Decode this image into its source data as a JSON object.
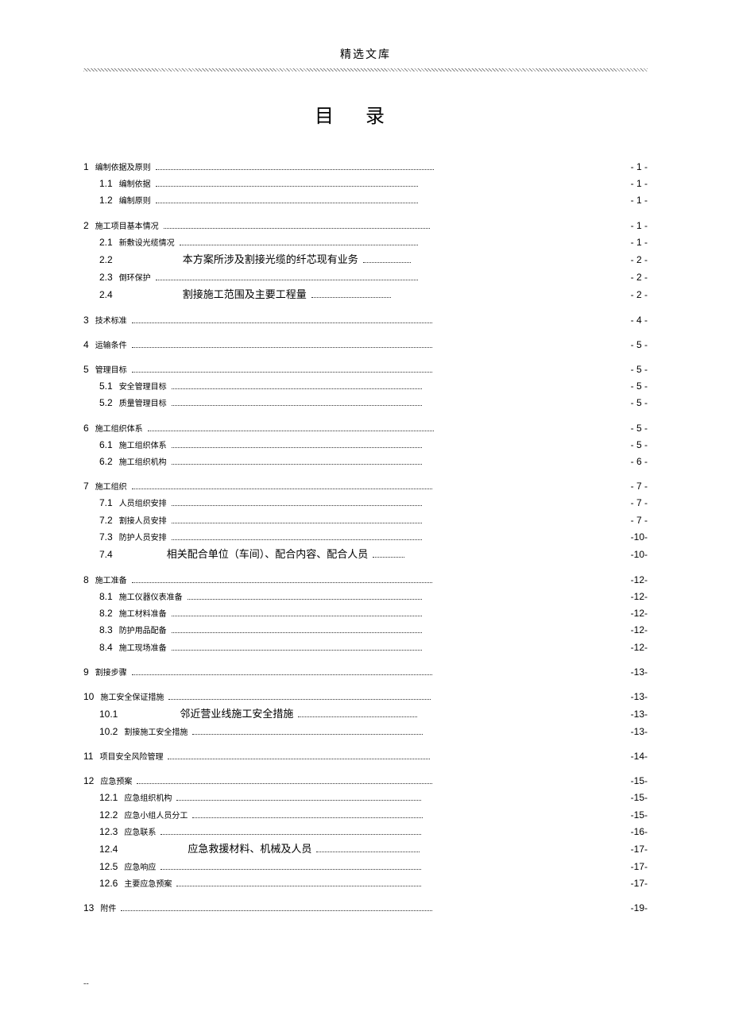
{
  "header": {
    "site": "精选文库"
  },
  "title": "目录",
  "toc": [
    {
      "level": 1,
      "num": "1",
      "label": "编制依据及原则",
      "page": "- 1 -",
      "dotw": 350
    },
    {
      "level": 2,
      "num": "1.1",
      "label": "编制依据",
      "page": "- 1 -",
      "dotw": 330
    },
    {
      "level": 2,
      "num": "1.2",
      "label": "编制原则",
      "page": "- 1 -",
      "dotw": 330
    },
    {
      "level": 1,
      "num": "2",
      "label": "施工项目基本情况",
      "page": "- 1 -",
      "dotw": 335
    },
    {
      "level": 2,
      "num": "2.1",
      "label": "新敷设光缆情况",
      "page": "- 1 -",
      "dotw": 300
    },
    {
      "level": 2,
      "num": "2.2",
      "label": "本方案所涉及割接光缆的纤芯现有业务",
      "big": true,
      "page": "- 2 -",
      "pad": 80,
      "dotw": 60
    },
    {
      "level": 2,
      "num": "2.3",
      "label": "倒环保护",
      "page": "- 2 -",
      "dotw": 330
    },
    {
      "level": 2,
      "num": "2.4",
      "label": "割接施工范围及主要工程量",
      "big": true,
      "page": "- 2 -",
      "pad": 80,
      "dotw": 100
    },
    {
      "level": 1,
      "num": "3",
      "label": "技术标准",
      "page": "- 4 -",
      "dotw": 378
    },
    {
      "level": 1,
      "num": "4",
      "label": "运输条件",
      "page": "- 5 -",
      "dotw": 378
    },
    {
      "level": 1,
      "num": "5",
      "label": "管理目标",
      "page": "- 5 -",
      "dotw": 378
    },
    {
      "level": 2,
      "num": "5.1",
      "label": "安全管理目标",
      "page": "- 5 -",
      "dotw": 315
    },
    {
      "level": 2,
      "num": "5.2",
      "label": "质量管理目标",
      "page": "- 5 -",
      "dotw": 315
    },
    {
      "level": 1,
      "num": "6",
      "label": "施工组织体系",
      "page": "- 5 -",
      "dotw": 360
    },
    {
      "level": 2,
      "num": "6.1",
      "label": "施工组织体系",
      "page": "- 5 -",
      "dotw": 315
    },
    {
      "level": 2,
      "num": "6.2",
      "label": "施工组织机构",
      "page": "- 6 -",
      "dotw": 315
    },
    {
      "level": 1,
      "num": "7",
      "label": "施工组织",
      "page": "- 7 -",
      "dotw": 378
    },
    {
      "level": 2,
      "num": "7.1",
      "label": "人员组织安排",
      "page": "- 7 -",
      "dotw": 315
    },
    {
      "level": 2,
      "num": "7.2",
      "label": "割接人员安排",
      "page": "- 7 -",
      "dotw": 315
    },
    {
      "level": 2,
      "num": "7.3",
      "label": "防护人员安排",
      "page": "-10-",
      "dotw": 315
    },
    {
      "level": 2,
      "num": "7.4",
      "label": "相关配合单位（车间）、配合内容、配合人员",
      "big": true,
      "page": "-10-",
      "pad": 60,
      "dotw": 20
    },
    {
      "level": 1,
      "num": "8",
      "label": "施工准备",
      "page": "-12-",
      "dotw": 378
    },
    {
      "level": 2,
      "num": "8.1",
      "label": "施工仪器仪表准备",
      "page": "-12-",
      "dotw": 295
    },
    {
      "level": 2,
      "num": "8.2",
      "label": "施工材料准备",
      "page": "-12-",
      "dotw": 315
    },
    {
      "level": 2,
      "num": "8.3",
      "label": "防护用品配备",
      "page": "-12-",
      "dotw": 315
    },
    {
      "level": 2,
      "num": "8.4",
      "label": "施工现场准备",
      "page": "-12-",
      "dotw": 315
    },
    {
      "level": 1,
      "num": "9",
      "label": "割接步骤",
      "page": "-13-",
      "dotw": 378
    },
    {
      "level": 1,
      "num": "10",
      "label": "施工安全保证措施",
      "page": "-13-",
      "dotw": 330
    },
    {
      "level": 2,
      "num": "10.1",
      "label": "邻近营业线施工安全措施",
      "big": true,
      "page": "-13-",
      "pad": 70,
      "dotw": 150
    },
    {
      "level": 2,
      "num": "10.2",
      "label": "割接施工安全措施",
      "page": "-13-",
      "dotw": 290
    },
    {
      "level": 1,
      "num": "11",
      "label": "项目安全风险管理",
      "page": "-14-",
      "dotw": 330
    },
    {
      "level": 1,
      "num": "12",
      "label": "应急预案",
      "page": "-15-",
      "dotw": 372
    },
    {
      "level": 2,
      "num": "12.1",
      "label": "应急组织机构",
      "page": "-15-",
      "dotw": 308
    },
    {
      "level": 2,
      "num": "12.2",
      "label": "应急小组人员分工",
      "page": "-15-",
      "dotw": 290
    },
    {
      "level": 2,
      "num": "12.3",
      "label": "应急联系",
      "page": "-16-",
      "dotw": 328
    },
    {
      "level": 2,
      "num": "12.4",
      "label": "应急救援材料、机械及人员",
      "big": true,
      "page": "-17-",
      "pad": 80,
      "dotw": 130
    },
    {
      "level": 2,
      "num": "12.5",
      "label": "应急响应",
      "page": "-17-",
      "dotw": 328
    },
    {
      "level": 2,
      "num": "12.6",
      "label": "主要应急预案",
      "page": "-17-",
      "dotw": 308
    },
    {
      "level": 1,
      "num": "13",
      "label": "附件",
      "page": "-19-",
      "dotw": 392
    }
  ],
  "footer": "--"
}
